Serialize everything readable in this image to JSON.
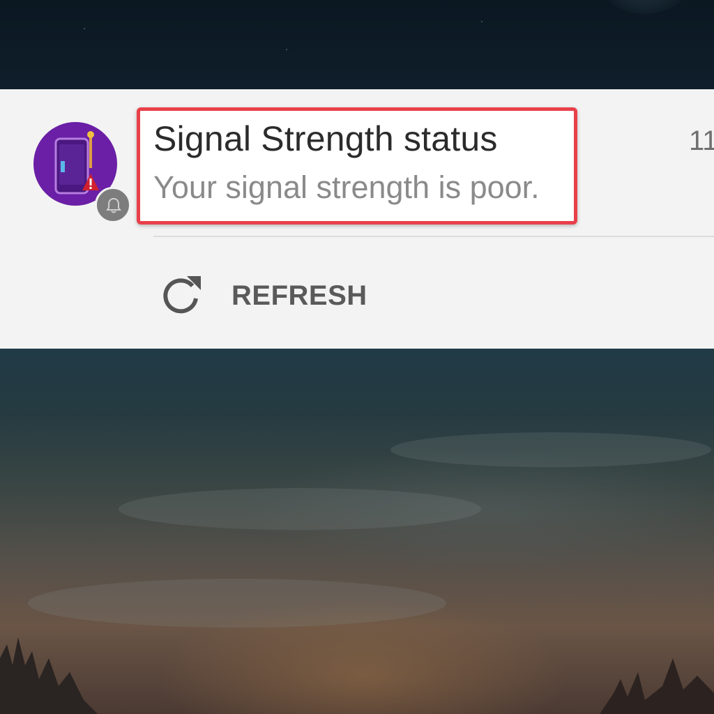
{
  "notification": {
    "title": "Signal Strength status",
    "message": "Your signal strength is poor.",
    "time": "11",
    "app_icon": "phone-signal-alert-icon",
    "badge_icon": "bell-icon",
    "action": {
      "label": "REFRESH",
      "icon": "refresh-icon"
    }
  },
  "colors": {
    "app_icon_bg": "#6a1fa6",
    "highlight_border": "#e8404a",
    "card_bg": "#f3f3f3"
  }
}
